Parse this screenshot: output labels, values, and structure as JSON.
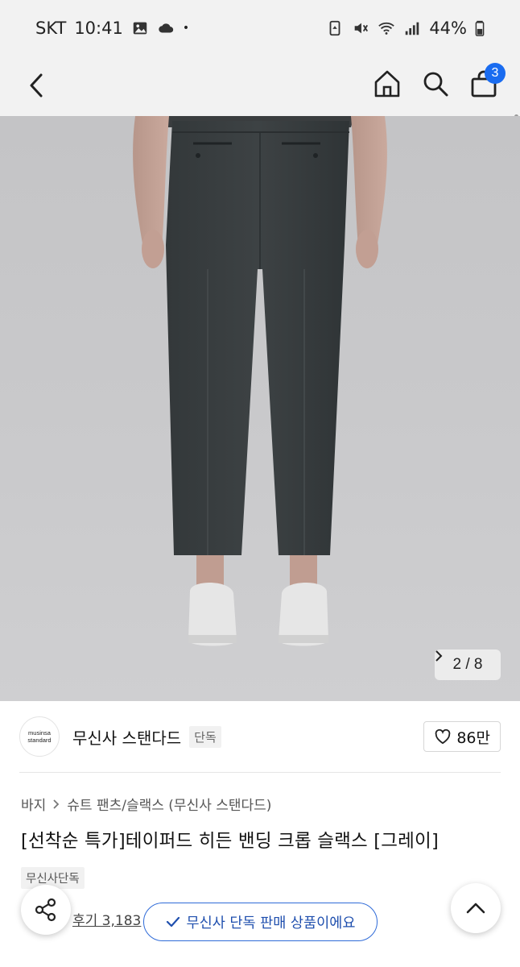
{
  "status_bar": {
    "carrier": "SKT",
    "time": "10:41",
    "dot": "•",
    "battery": "44%",
    "left_icons": [
      "image-icon",
      "cloud-icon"
    ],
    "right_icons": [
      "battery-saver-icon",
      "mute-icon",
      "wifi-icon",
      "signal-icon",
      "battery-icon"
    ]
  },
  "header": {
    "cart_count": "3",
    "icons": [
      "back-icon",
      "home-icon",
      "search-icon",
      "cart-icon"
    ]
  },
  "gallery": {
    "counter": "2 / 8",
    "current": 2,
    "total": 8
  },
  "brand": {
    "logo_line1": "musinsa",
    "logo_line2": "standard",
    "name": "무신사 스탠다드",
    "tag": "단독",
    "likes": "86만"
  },
  "breadcrumb": {
    "items": [
      "바지",
      "슈트 팬츠/슬랙스 (무신사 스탠다드)"
    ]
  },
  "product": {
    "title": "[선착순 특가]테이퍼드 히든 밴딩 크롭 슬랙스 [그레이]",
    "exclusive_tag": "무신사단독",
    "review_text": "후기 3,183"
  },
  "toast": {
    "text": "무신사 단독 판매 상품이에요"
  },
  "colors": {
    "accent": "#1a6cf0",
    "toast_text": "#1f4fae",
    "header_bg": "#f2f2f2"
  }
}
